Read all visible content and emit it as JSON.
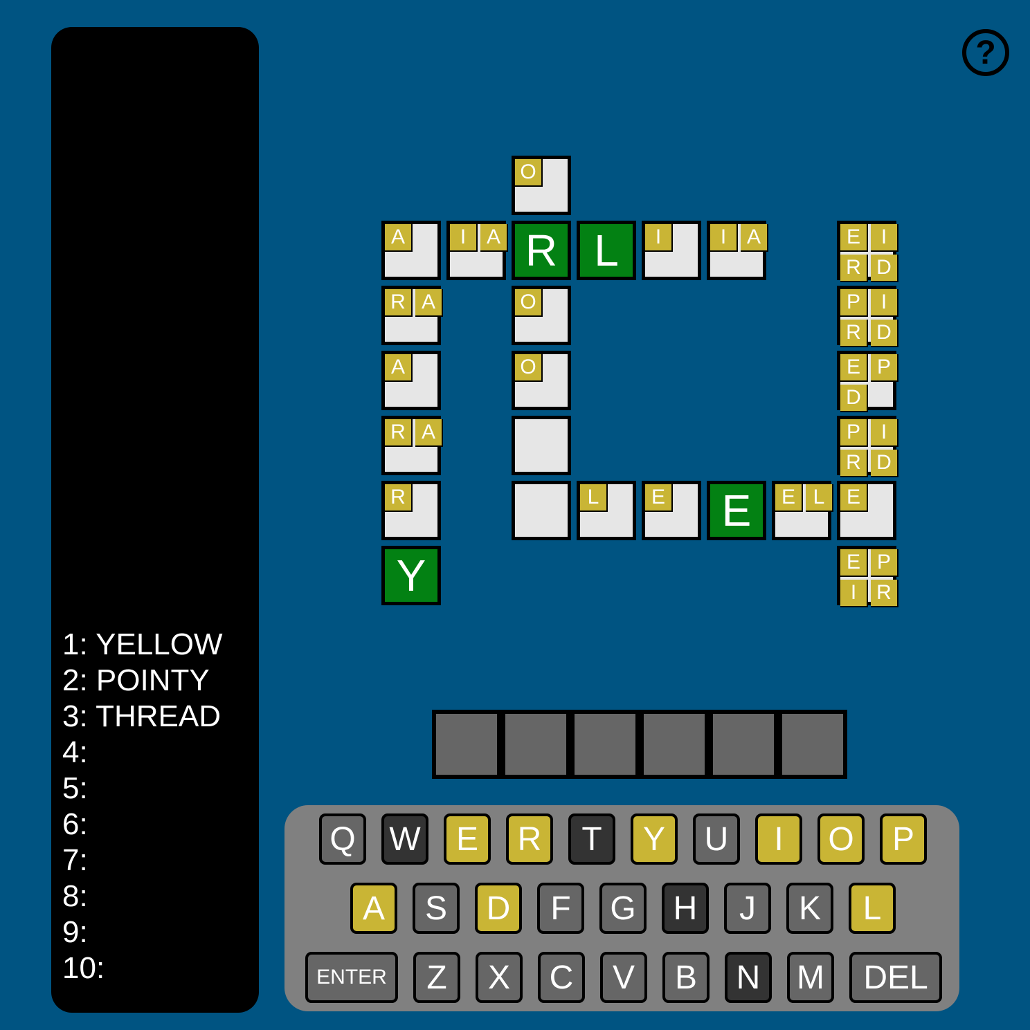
{
  "guesses": [
    {
      "label": "1:",
      "word": "YELLOW"
    },
    {
      "label": "2:",
      "word": "POINTY"
    },
    {
      "label": "3:",
      "word": "THREAD"
    },
    {
      "label": "4:",
      "word": ""
    },
    {
      "label": "5:",
      "word": ""
    },
    {
      "label": "6:",
      "word": ""
    },
    {
      "label": "7:",
      "word": ""
    },
    {
      "label": "8:",
      "word": ""
    },
    {
      "label": "9:",
      "word": ""
    },
    {
      "label": "10:",
      "word": ""
    }
  ],
  "help": {
    "icon": "help-icon",
    "symbol": "?"
  },
  "colors": {
    "background": "#005482",
    "green": "#038113",
    "yellow": "#c9b535",
    "empty": "#e6e6e6",
    "key_gray": "#666666",
    "key_dark": "#333333",
    "keyboard_panel": "#808080"
  },
  "grid": {
    "cells": [
      {
        "col": 2,
        "row": 0,
        "hints": [
          "O"
        ]
      },
      {
        "col": 0,
        "row": 1,
        "hints": [
          "A"
        ]
      },
      {
        "col": 1,
        "row": 1,
        "hints": [
          "I",
          "A"
        ]
      },
      {
        "col": 2,
        "row": 1,
        "letter": "R"
      },
      {
        "col": 3,
        "row": 1,
        "letter": "L"
      },
      {
        "col": 4,
        "row": 1,
        "hints": [
          "I"
        ]
      },
      {
        "col": 5,
        "row": 1,
        "hints": [
          "I",
          "A"
        ]
      },
      {
        "col": 7,
        "row": 1,
        "hints": [
          "E",
          "I",
          "R",
          "D"
        ]
      },
      {
        "col": 0,
        "row": 2,
        "hints": [
          "R",
          "A"
        ]
      },
      {
        "col": 2,
        "row": 2,
        "hints": [
          "O"
        ]
      },
      {
        "col": 7,
        "row": 2,
        "hints": [
          "P",
          "I",
          "R",
          "D"
        ]
      },
      {
        "col": 0,
        "row": 3,
        "hints": [
          "A"
        ]
      },
      {
        "col": 2,
        "row": 3,
        "hints": [
          "O"
        ]
      },
      {
        "col": 7,
        "row": 3,
        "hints": [
          "E",
          "P",
          "D"
        ]
      },
      {
        "col": 0,
        "row": 4,
        "hints": [
          "R",
          "A"
        ]
      },
      {
        "col": 2,
        "row": 4,
        "hints": []
      },
      {
        "col": 7,
        "row": 4,
        "hints": [
          "P",
          "I",
          "R",
          "D"
        ]
      },
      {
        "col": 0,
        "row": 5,
        "hints": [
          "R"
        ]
      },
      {
        "col": 2,
        "row": 5,
        "hints": []
      },
      {
        "col": 3,
        "row": 5,
        "hints": [
          "L"
        ]
      },
      {
        "col": 4,
        "row": 5,
        "hints": [
          "E"
        ]
      },
      {
        "col": 5,
        "row": 5,
        "letter": "E"
      },
      {
        "col": 6,
        "row": 5,
        "hints": [
          "E",
          "L"
        ]
      },
      {
        "col": 7,
        "row": 5,
        "hints": [
          "E"
        ]
      },
      {
        "col": 0,
        "row": 6,
        "letter": "Y"
      },
      {
        "col": 7,
        "row": 6,
        "hints": [
          "E",
          "P",
          "I",
          "R"
        ]
      }
    ]
  },
  "entry": {
    "slots": [
      "",
      "",
      "",
      "",
      "",
      ""
    ]
  },
  "keyboard": {
    "rows": [
      [
        {
          "label": "Q",
          "state": "gray"
        },
        {
          "label": "W",
          "state": "dark"
        },
        {
          "label": "E",
          "state": "yellow"
        },
        {
          "label": "R",
          "state": "yellow"
        },
        {
          "label": "T",
          "state": "dark"
        },
        {
          "label": "Y",
          "state": "yellow"
        },
        {
          "label": "U",
          "state": "gray"
        },
        {
          "label": "I",
          "state": "yellow"
        },
        {
          "label": "O",
          "state": "yellow"
        },
        {
          "label": "P",
          "state": "yellow"
        }
      ],
      [
        {
          "label": "A",
          "state": "yellow"
        },
        {
          "label": "S",
          "state": "gray"
        },
        {
          "label": "D",
          "state": "yellow"
        },
        {
          "label": "F",
          "state": "gray"
        },
        {
          "label": "G",
          "state": "gray"
        },
        {
          "label": "H",
          "state": "dark"
        },
        {
          "label": "J",
          "state": "gray"
        },
        {
          "label": "K",
          "state": "gray"
        },
        {
          "label": "L",
          "state": "yellow"
        }
      ],
      [
        {
          "label": "ENTER",
          "state": "gray"
        },
        {
          "label": "Z",
          "state": "gray"
        },
        {
          "label": "X",
          "state": "gray"
        },
        {
          "label": "C",
          "state": "gray"
        },
        {
          "label": "V",
          "state": "gray"
        },
        {
          "label": "B",
          "state": "gray"
        },
        {
          "label": "N",
          "state": "dark"
        },
        {
          "label": "M",
          "state": "gray"
        },
        {
          "label": "DEL",
          "state": "gray"
        }
      ]
    ]
  }
}
